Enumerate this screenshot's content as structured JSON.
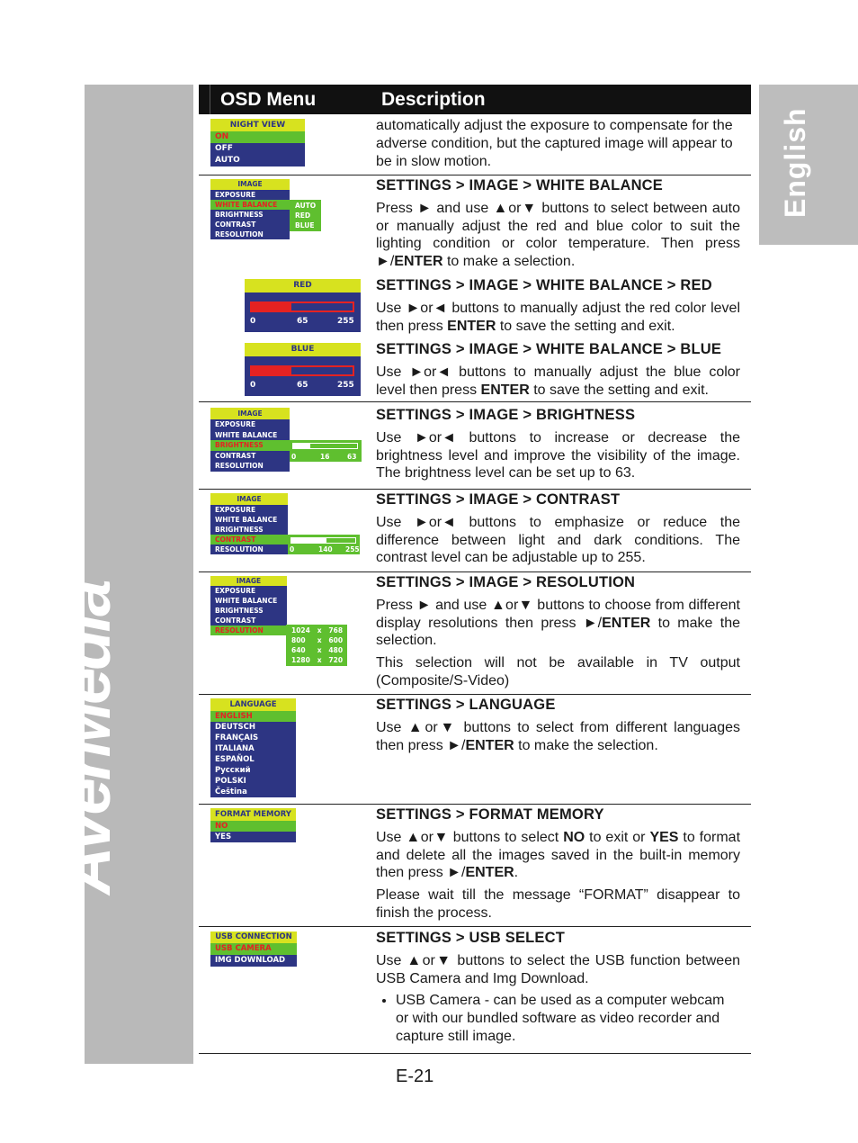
{
  "header": {
    "col1": "OSD Menu",
    "col2": "Description"
  },
  "side_tab": "English",
  "logo_text": "AVerMedia",
  "page_number": "E-21",
  "colors": {
    "osd_title": "#d7e21f",
    "osd_selected": "#5fbf2f",
    "osd_item": "#2d3583",
    "osd_selected_text": "#e52222",
    "side_gray": "#b9b9b9"
  },
  "menus": [
    {
      "title": "NIGHT VIEW",
      "items": [
        "ON",
        "OFF",
        "AUTO"
      ],
      "selected": 0
    },
    {
      "title": "IMAGE",
      "items": [
        "EXPOSURE",
        "WHITE BALANCE",
        "BRIGHTNESS",
        "CONTRAST",
        "RESOLUTION"
      ],
      "selected": 1,
      "submenu": [
        "AUTO",
        "RED",
        "BLUE"
      ]
    },
    {
      "title": "IMAGE",
      "items": [
        "EXPOSURE",
        "WHITE BALANCE",
        "BRIGHTNESS",
        "CONTRAST",
        "RESOLUTION"
      ],
      "selected": 2,
      "slider": {
        "min": "0",
        "value": "16",
        "max": "63"
      }
    },
    {
      "title": "IMAGE",
      "items": [
        "EXPOSURE",
        "WHITE BALANCE",
        "BRIGHTNESS",
        "CONTRAST",
        "RESOLUTION"
      ],
      "selected": 3,
      "slider": {
        "min": "0",
        "value": "140",
        "max": "255"
      }
    },
    {
      "title": "IMAGE",
      "items": [
        "EXPOSURE",
        "WHITE BALANCE",
        "BRIGHTNESS",
        "CONTRAST",
        "RESOLUTION"
      ],
      "selected": 4,
      "submenu": [
        "1024   x   768",
        "800     x   600",
        "640     x   480",
        "1280   x   720"
      ]
    },
    {
      "title": "LANGUAGE",
      "items": [
        "ENGLISH",
        "DEUTSCH",
        "FRANÇAIS",
        "ITALIANA",
        "ESPAÑOL",
        "Русский",
        "POLSKI",
        "Čeština"
      ],
      "selected": 0
    },
    {
      "title": "FORMAT MEMORY",
      "items": [
        "NO",
        "YES"
      ],
      "selected": 0
    },
    {
      "title": "USB CONNECTION",
      "items": [
        "USB CAMERA",
        "IMG DOWNLOAD"
      ],
      "selected": 0
    }
  ],
  "sliders": [
    {
      "title": "RED",
      "min": "0",
      "value": "65",
      "max": "255"
    },
    {
      "title": "BLUE",
      "min": "0",
      "value": "65",
      "max": "255"
    }
  ],
  "blocks": [
    {
      "paras": [
        [
          "automatically adjust the exposure to compensate for the adverse condition, but the captured image will appear to be in slow motion."
        ]
      ]
    },
    {
      "heading": "SETTINGS > IMAGE > WHITE BALANCE",
      "paras": [
        [
          "Press ► and use ▲or▼ buttons to select between auto or manually adjust the red and blue color to suit the lighting condition or color temperature. Then press ►/",
          {
            "b": "ENTER"
          },
          " to make a selection."
        ]
      ]
    },
    {
      "heading": "SETTINGS > IMAGE > WHITE BALANCE > RED",
      "paras": [
        [
          "Use ►or◄ buttons to manually adjust the red color level then press ",
          {
            "b": "ENTER"
          },
          " to save the setting and exit."
        ]
      ]
    },
    {
      "heading": "SETTINGS > IMAGE > WHITE BALANCE > BLUE",
      "paras": [
        [
          "Use ►or◄ buttons to manually adjust the blue color level then press ",
          {
            "b": "ENTER"
          },
          " to save the setting and exit."
        ]
      ]
    },
    {
      "heading": "SETTINGS > IMAGE > BRIGHTNESS",
      "paras": [
        [
          "Use ►or◄ buttons to increase or decrease the brightness level and improve the visibility of the image. The brightness level can be set up to 63."
        ]
      ]
    },
    {
      "heading": "SETTINGS > IMAGE > CONTRAST",
      "paras": [
        [
          "Use ►or◄ buttons to emphasize or reduce the difference between light and dark conditions. The contrast level can be adjustable up to 255."
        ]
      ]
    },
    {
      "heading": "SETTINGS > IMAGE > RESOLUTION",
      "paras": [
        [
          "Press ► and use ▲or▼ buttons to choose from different display resolutions then press ►/",
          {
            "b": "ENTER"
          },
          " to make the selection."
        ],
        [
          "This selection will not be available in TV output (Composite/S-Video)"
        ]
      ]
    },
    {
      "heading": "SETTINGS > LANGUAGE",
      "paras": [
        [
          "Use ▲or▼ buttons to select from different languages then press ►/",
          {
            "b": "ENTER"
          },
          " to make the selection."
        ]
      ]
    },
    {
      "heading": "SETTINGS > FORMAT MEMORY",
      "paras": [
        [
          "Use ▲or▼ buttons to select ",
          {
            "b": "NO"
          },
          " to exit or ",
          {
            "b": "YES"
          },
          " to format and delete all the images saved in the built-in memory then press ►/",
          {
            "b": "ENTER"
          },
          "."
        ],
        [
          "Please wait till the message “FORMAT” disappear to finish the process."
        ]
      ]
    },
    {
      "heading": "SETTINGS > USB SELECT",
      "paras": [
        [
          "Use ▲or▼ buttons to select the USB function between USB Camera and Img Download."
        ]
      ],
      "bullets": [
        "USB Camera - can be used as a computer webcam or with our bundled software as video recorder and capture still image."
      ]
    }
  ]
}
